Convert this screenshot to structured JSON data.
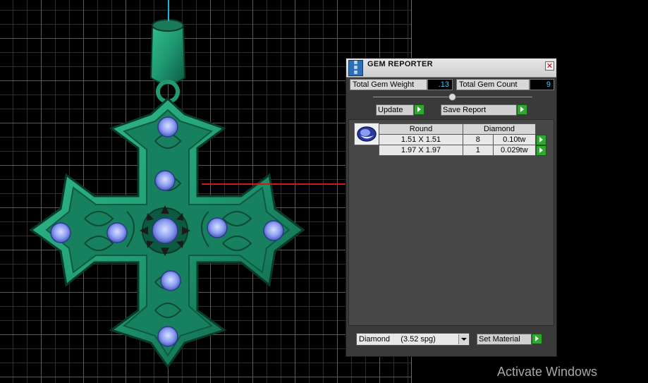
{
  "panel": {
    "title": "GEM REPORTER",
    "close_glyph": "✕",
    "total_weight_label": "Total Gem Weight",
    "total_weight_value": ".13",
    "total_count_label": "Total Gem Count",
    "total_count_value": "9",
    "update_label": "Update",
    "save_report_label": "Save Report",
    "table": {
      "headers": [
        "Round",
        "Diamond"
      ],
      "rows": [
        {
          "size": "1.51 X 1.51",
          "count": "8",
          "weight": "0.10tw"
        },
        {
          "size": "1.97 X 1.97",
          "count": "1",
          "weight": "0.029tw"
        }
      ]
    },
    "material_selected": "Diamond     (3.52 spg)",
    "set_material_label": "Set Material"
  },
  "overlay": {
    "activate_windows": "Activate Windows"
  },
  "colors": {
    "pendant": "#1f9a72",
    "gem": "#8a9cf0",
    "value_text": "#3fc8ff",
    "go_button": "#2ea82e"
  },
  "icons": [
    "gem-reporter-icon",
    "close-icon",
    "slider-knob",
    "go-arrow-icon",
    "dropdown-arrow-icon",
    "gem-thumbnail-icon"
  ]
}
